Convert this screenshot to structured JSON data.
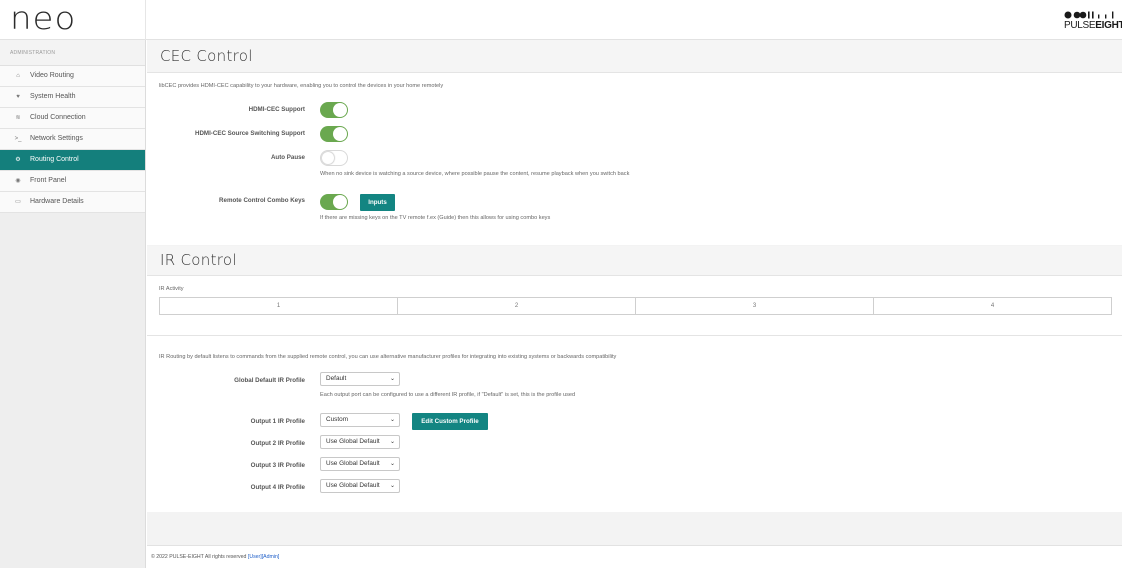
{
  "header": {
    "logo": "neo",
    "brand_pulse": "PULSE",
    "brand_eight": "EIGHT"
  },
  "sidebar": {
    "section": "ADMINISTRATION",
    "items": [
      {
        "label": "Video Routing",
        "icon": "home-icon",
        "glyph": "⌂",
        "active": false
      },
      {
        "label": "System Health",
        "icon": "heart-icon",
        "glyph": "♥",
        "active": false
      },
      {
        "label": "Cloud Connection",
        "icon": "wifi-icon",
        "glyph": "≋",
        "active": false
      },
      {
        "label": "Network Settings",
        "icon": "terminal-icon",
        "glyph": ">_",
        "active": false
      },
      {
        "label": "Routing Control",
        "icon": "cogs-icon",
        "glyph": "⚙",
        "active": true
      },
      {
        "label": "Front Panel",
        "icon": "circle-icon",
        "glyph": "◉",
        "active": false
      },
      {
        "label": "Hardware Details",
        "icon": "hdd-icon",
        "glyph": "▭",
        "active": false
      }
    ]
  },
  "cec": {
    "title": "CEC Control",
    "description": "libCEC provides HDMI-CEC capability to your hardware, enabling you to control the devices in your home remotely",
    "hdmi_cec_label": "HDMI-CEC Support",
    "hdmi_cec_on": true,
    "source_switching_label": "HDMI-CEC Source Switching Support",
    "source_switching_on": true,
    "auto_pause_label": "Auto Pause",
    "auto_pause_on": false,
    "auto_pause_help": "When no sink device is watching a source device, where possible pause the content, resume playback when you switch back",
    "combo_keys_label": "Remote Control Combo Keys",
    "combo_keys_on": true,
    "inputs_button": "Inputs",
    "combo_keys_help": "If there are missing keys on the TV remote f.ex (Guide) then this allows for using combo keys"
  },
  "ir": {
    "title": "IR Control",
    "activity_label": "IR Activity",
    "activity_cells": [
      "1",
      "2",
      "3",
      "4"
    ],
    "routing_description": "IR Routing by default listens to commands from the supplied remote control, you can use alternative manufacturer profiles for integrating into existing systems or backwards compatibility",
    "global_label": "Global Default IR Profile",
    "global_value": "Default",
    "global_help": "Each output port can be configured to use a different IR profile, if \"Default\" is set, this is the profile used",
    "outputs": [
      {
        "label": "Output 1 IR Profile",
        "value": "Custom"
      },
      {
        "label": "Output 2 IR Profile",
        "value": "Use Global Default"
      },
      {
        "label": "Output 3 IR Profile",
        "value": "Use Global Default"
      },
      {
        "label": "Output 4 IR Profile",
        "value": "Use Global Default"
      }
    ],
    "edit_button": "Edit Custom Profile"
  },
  "footer": {
    "text": "© 2022 PULSE-EIGHT All rights reserved",
    "user_link": "[User]",
    "admin_link": "[Admin]"
  },
  "colors": {
    "accent": "#138582",
    "toggle_on": "#6aa84f",
    "link": "#1f5fc9"
  }
}
